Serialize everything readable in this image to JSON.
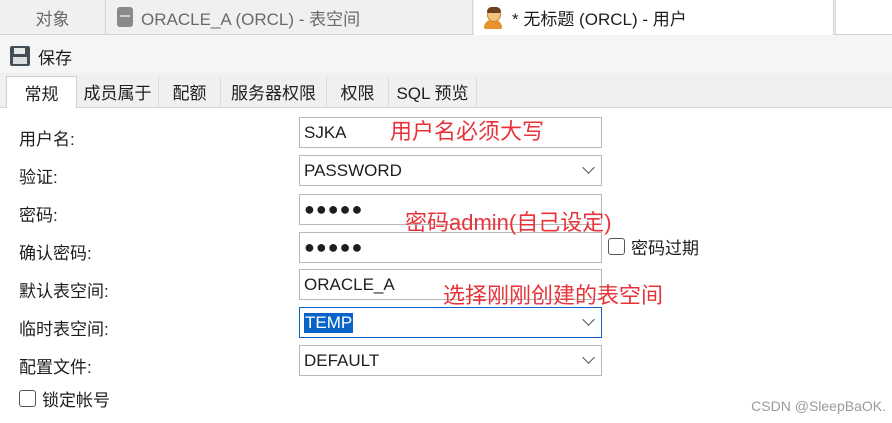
{
  "window_tabs": {
    "objects": "对象",
    "tablespace": "ORACLE_A (ORCL) - 表空间",
    "user": "* 无标题 (ORCL) - 用户"
  },
  "toolbar": {
    "save_label": "保存"
  },
  "sub_tabs": [
    "常规",
    "成员属于",
    "配额",
    "服务器权限",
    "权限",
    "SQL 预览"
  ],
  "form": {
    "username": {
      "label": "用户名:",
      "value": "SJKA"
    },
    "auth": {
      "label": "验证:",
      "value": "PASSWORD"
    },
    "password": {
      "label": "密码:",
      "value": "●●●●●"
    },
    "confirm_password": {
      "label": "确认密码:",
      "value": "●●●●●"
    },
    "password_expired_label": "密码过期",
    "default_tablespace": {
      "label": "默认表空间:",
      "value": "ORACLE_A"
    },
    "temp_tablespace": {
      "label": "临时表空间:",
      "value": "TEMP"
    },
    "profile": {
      "label": "配置文件:",
      "value": "DEFAULT"
    },
    "lock_account_label": "锁定帐号"
  },
  "annotations": {
    "username_note": "用户名必须大写",
    "password_note": "密码admin(自己设定)",
    "tablespace_note": "选择刚刚创建的表空间"
  },
  "watermark": "CSDN @SleepBaOK.",
  "colors": {
    "annotation": "#e8333a",
    "selection": "#0a64c8"
  }
}
